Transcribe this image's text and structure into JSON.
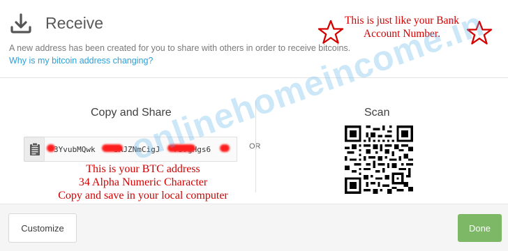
{
  "header": {
    "title": "Receive",
    "description": "A new address has been created for you to share with others in order to receive bitcoins.",
    "why_link": "Why is my bitcoin address changing?",
    "icon": "download-icon"
  },
  "annotations": {
    "bank_line1": "This is just like your Bank",
    "bank_line2": "Account Number.",
    "btc_line1": "This is your BTC address",
    "btc_line2": "34 Alpha Numeric Character",
    "btc_line3": "Copy and save in your local computer",
    "color": "#d40000"
  },
  "copy_share": {
    "title": "Copy and Share",
    "address_visible": "3YvubMQwk    3AJZNmCigJ   FJ7gHgs6",
    "clipboard_icon": "clipboard-icon"
  },
  "or_label": "OR",
  "scan": {
    "title": "Scan"
  },
  "watermark": "onlinehomeincome.in",
  "footer": {
    "customize_label": "Customize",
    "done_label": "Done",
    "done_color": "#7cb865"
  }
}
